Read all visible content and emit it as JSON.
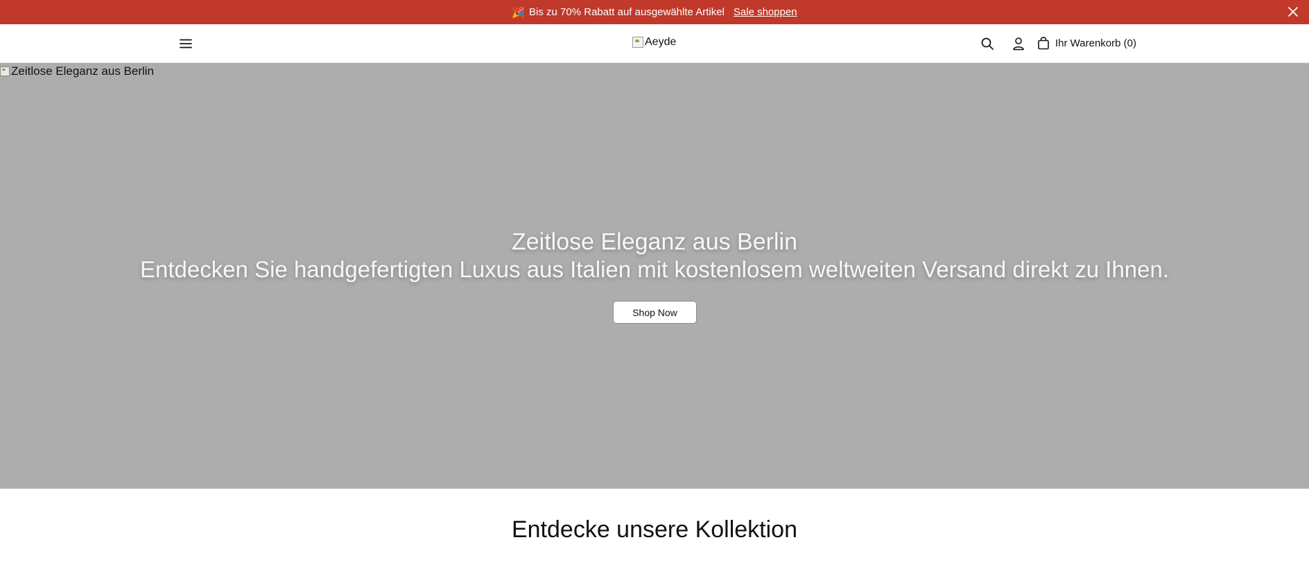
{
  "announcement": {
    "emoji": "🎉",
    "text": "Bis zu 70% Rabatt auf ausgewählte Artikel",
    "link": "Sale shoppen",
    "close_icon": "close-icon"
  },
  "header": {
    "menu_icon": "hamburger-menu-icon",
    "logo_alt": "Aeyde",
    "search_icon": "search-icon",
    "account_icon": "account-icon",
    "cart_icon": "shopping-bag-icon",
    "cart_label": "Ihr Warenkorb (0)"
  },
  "hero": {
    "image_alt": "Zeitlose Eleganz aus Berlin",
    "title": "Zeitlose Eleganz aus Berlin",
    "subtitle": "Entdecken Sie handgefertigten Luxus aus Italien mit kostenlosem weltweiten Versand direkt zu Ihnen.",
    "cta": "Shop Now"
  },
  "collection": {
    "title": "Entdecke unsere Kollektion"
  },
  "colors": {
    "announcement_bg": "#c0392b",
    "hero_bg": "#adadad"
  }
}
